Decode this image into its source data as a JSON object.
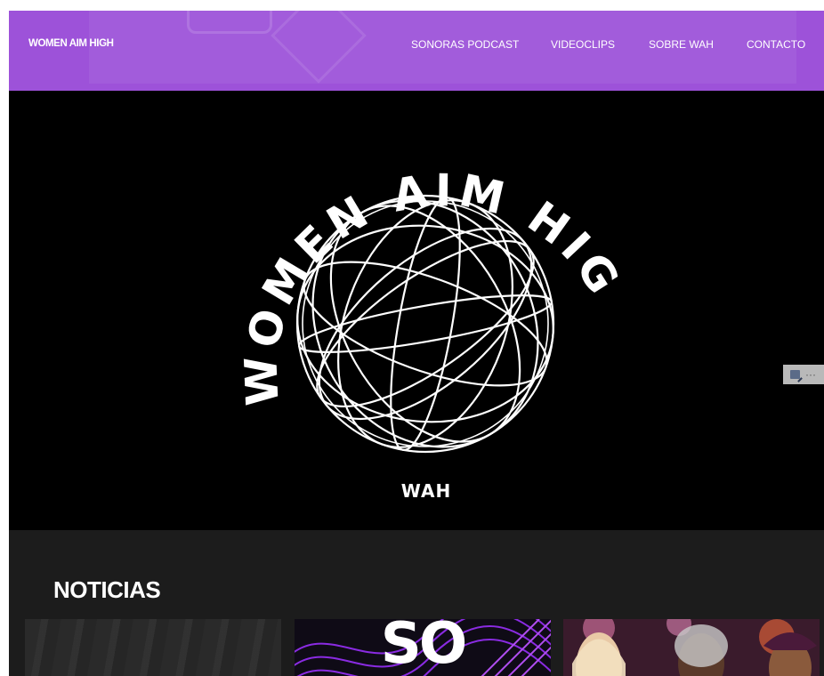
{
  "header": {
    "site_title": "WOMEN AIM HIGH",
    "background_color": "#9d52d9",
    "nav": [
      {
        "label": "SONORAS PODCAST"
      },
      {
        "label": "VIDEOCLIPS"
      },
      {
        "label": "SOBRE WAH"
      },
      {
        "label": "CONTACTO"
      }
    ]
  },
  "hero": {
    "logo_arc_text": "WOMEN AIM HIGH",
    "logo_subtext": "WAH",
    "logo_icon": "globe-icon",
    "background_color": "#000000"
  },
  "admin_widget": {
    "icons": [
      "edit-icon",
      "more-icon"
    ],
    "more_label": "···"
  },
  "news": {
    "title": "NOTICIAS",
    "cards": [
      {
        "name": "news-card-1",
        "image_text": ""
      },
      {
        "name": "news-card-2",
        "image_text": "SO"
      },
      {
        "name": "news-card-3",
        "image_text": ""
      }
    ]
  }
}
